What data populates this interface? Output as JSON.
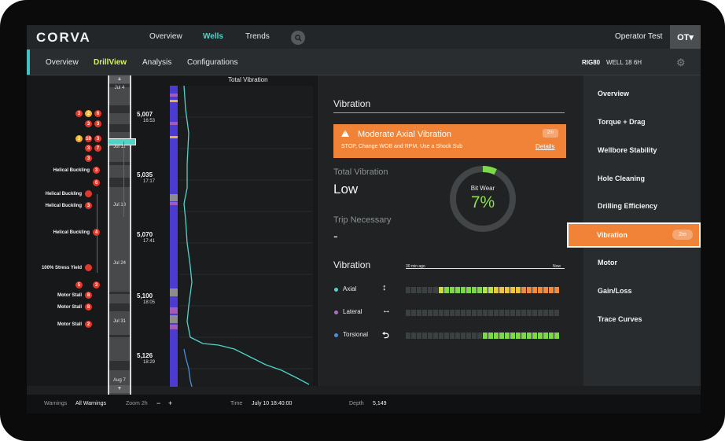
{
  "app": {
    "logo": "CORVA"
  },
  "topnav": {
    "items": [
      "Overview",
      "Wells",
      "Trends"
    ],
    "active": "Wells"
  },
  "user": {
    "name": "Operator Test",
    "initials": "OT▾"
  },
  "subnav": {
    "items": [
      "Overview",
      "DrillView",
      "Analysis",
      "Configurations"
    ],
    "active": "DrillView"
  },
  "well": {
    "rig": "RIG80",
    "name": "WELL 18 6H"
  },
  "drillview": {
    "chart_title": "Total Vibration",
    "timeline_dates": [
      "Jul 4",
      "Jul 11",
      "Jul 18",
      "Jul 24",
      "Jul 31",
      "Aug 7"
    ],
    "event_labels": [
      "Helical Buckling",
      "Helical Buckling",
      "Helical Buckling",
      "Helical Buckling",
      "100% Stress Yield",
      "Motor Stall",
      "Motor Stall",
      "Motor Stall"
    ],
    "event_counts": [
      "3",
      "2",
      "6",
      "3",
      "3",
      "3",
      "10",
      "3",
      "3",
      "7",
      "3",
      "3",
      "6",
      "3",
      "4",
      "5",
      "3",
      "8",
      "8",
      "2"
    ],
    "depths": [
      {
        "value": "5,007",
        "time": "16:53"
      },
      {
        "value": "5,035",
        "time": "17:17"
      },
      {
        "value": "5,070",
        "time": "17:41"
      },
      {
        "value": "5,100",
        "time": "18:05"
      },
      {
        "value": "5,126",
        "time": "18:29"
      }
    ]
  },
  "vibration": {
    "title": "Vibration",
    "alert": {
      "title": "Moderate Axial Vibration",
      "subtitle": "STOP, Change WOB and RPM, Use a Shock Sub",
      "time": "2m",
      "link": "Details"
    },
    "total_label": "Total Vibration",
    "total_value": "Low",
    "trip_label": "Trip Necessary",
    "trip_value": "-",
    "bit_wear_label": "Bit Wear",
    "bit_wear_value": "7%",
    "bit_wear_fraction": 0.07,
    "section_title": "Vibration",
    "axis_start": "30 min ago",
    "axis_end": "Now",
    "rows": [
      {
        "label": "Axial",
        "color": "#4fd4c8",
        "icon": "↕"
      },
      {
        "label": "Lateral",
        "color": "#b06ac8",
        "icon": "↔"
      },
      {
        "label": "Torsional",
        "color": "#4a90d9",
        "icon": "⮌"
      }
    ]
  },
  "sidebar": {
    "items": [
      "Overview",
      "Torque + Drag",
      "Wellbore Stability",
      "Hole Cleaning",
      "Drilling Efficiency",
      "Vibration",
      "Motor",
      "Gain/Loss",
      "Trace Curves"
    ],
    "active": "Vibration",
    "active_badge": "2m"
  },
  "footer": {
    "warnings_label": "Warnings",
    "warnings_value": "All Warnings",
    "zoom_label": "Zoom 2h",
    "zoom_minus": "−",
    "zoom_plus": "+",
    "time_label": "Time",
    "time_value": "July 10 18:40:00",
    "depth_label": "Depth",
    "depth_value": "5,149"
  }
}
